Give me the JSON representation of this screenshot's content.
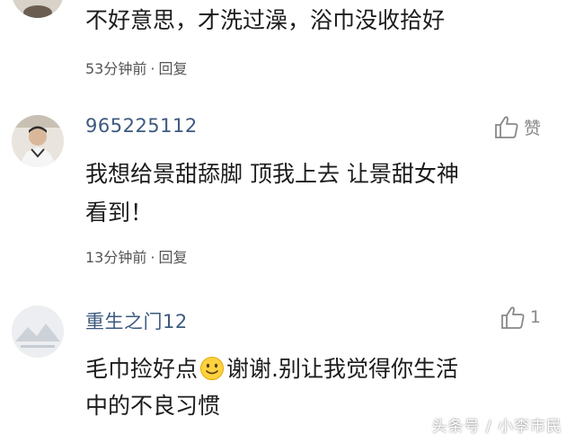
{
  "comments": [
    {
      "text": "不好意思，才洗过澡，浴巾没收拾好",
      "time": "53分钟前",
      "reply": "回复",
      "separator": "·"
    },
    {
      "username": "965225112",
      "text_line1": "我想给景甜舔脚  顶我上去 让景甜女神",
      "text_line2": "看到！",
      "time": "13分钟前",
      "reply": "回复",
      "separator": "·",
      "like_label": "赞"
    },
    {
      "username": "重生之门12",
      "text_line1_a": "毛巾捡好点",
      "text_line1_b": "谢谢.别让我觉得你生活",
      "text_line2": "中的不良习惯",
      "like_count": "1"
    }
  ],
  "watermark": "头条号 / 小李市民",
  "colors": {
    "username": "#3d5a80",
    "meta": "#555555",
    "like": "#888888"
  },
  "icons": [
    "avatar",
    "thumbs-up-icon",
    "smile-emoji-icon"
  ]
}
